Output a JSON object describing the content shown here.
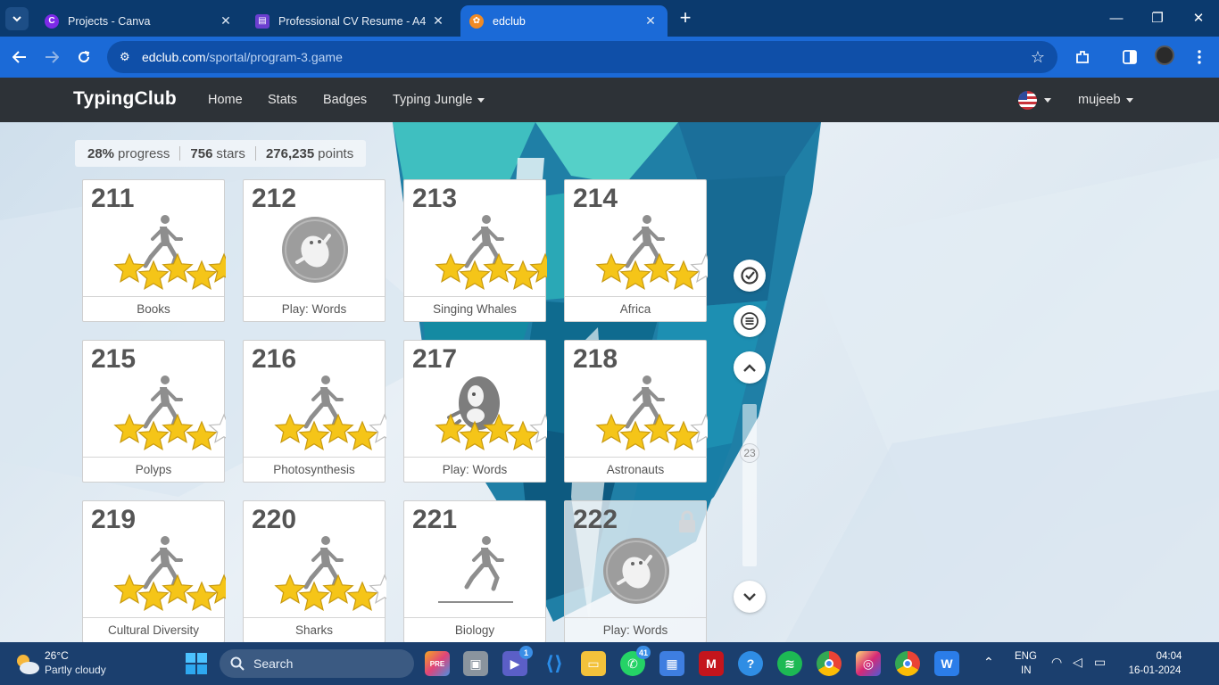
{
  "browser": {
    "tabs": [
      {
        "title": "Projects - Canva",
        "icon": "canva-icon",
        "active": false
      },
      {
        "title": "Professional CV Resume - A4",
        "icon": "document-icon",
        "active": false
      },
      {
        "title": "edclub",
        "icon": "edclub-icon",
        "active": true
      }
    ],
    "url_domain": "edclub.com",
    "url_path": "/sportal/program-3.game"
  },
  "nav": {
    "brand": "TypingClub",
    "links": [
      "Home",
      "Stats",
      "Badges"
    ],
    "dropdown": "Typing Jungle",
    "user": "mujeeb"
  },
  "progress": {
    "percent": "28%",
    "percent_label": "progress",
    "stars": "756",
    "stars_label": "stars",
    "points": "276,235",
    "points_label": "points"
  },
  "lessons": [
    {
      "number": "211",
      "title": "Books",
      "type": "runner",
      "stars": 5
    },
    {
      "number": "212",
      "title": "Play: Words",
      "type": "game",
      "stars": 0
    },
    {
      "number": "213",
      "title": "Singing Whales",
      "type": "runner",
      "stars": 5
    },
    {
      "number": "214",
      "title": "Africa",
      "type": "runner",
      "stars": 4
    },
    {
      "number": "215",
      "title": "Polyps",
      "type": "runner",
      "stars": 4
    },
    {
      "number": "216",
      "title": "Photosynthesis",
      "type": "runner",
      "stars": 4
    },
    {
      "number": "217",
      "title": "Play: Words",
      "type": "monster",
      "stars": 4
    },
    {
      "number": "218",
      "title": "Astronauts",
      "type": "runner",
      "stars": 4
    },
    {
      "number": "219",
      "title": "Cultural Diversity",
      "type": "runner",
      "stars": 5
    },
    {
      "number": "220",
      "title": "Sharks",
      "type": "runner",
      "stars": 4
    },
    {
      "number": "221",
      "title": "Biology",
      "type": "runner-plain",
      "stars": 0
    },
    {
      "number": "222",
      "title": "Play: Words",
      "type": "game-locked",
      "stars": 0
    }
  ],
  "sidebar": {
    "scroll_value": "23"
  },
  "taskbar": {
    "temperature": "26°C",
    "weather": "Partly cloudy",
    "search_placeholder": "Search",
    "teams_badge": "1",
    "whatsapp_badge": "41",
    "lang": "ENG",
    "region": "IN",
    "time": "04:04",
    "date": "16-01-2024"
  },
  "colors": {
    "browser_tab_bar": "#0b3a6e",
    "browser_toolbar": "#1b6ad7",
    "site_nav": "#2d3237",
    "star_gold": "#f5c518",
    "taskbar": "#1b3f6e"
  }
}
